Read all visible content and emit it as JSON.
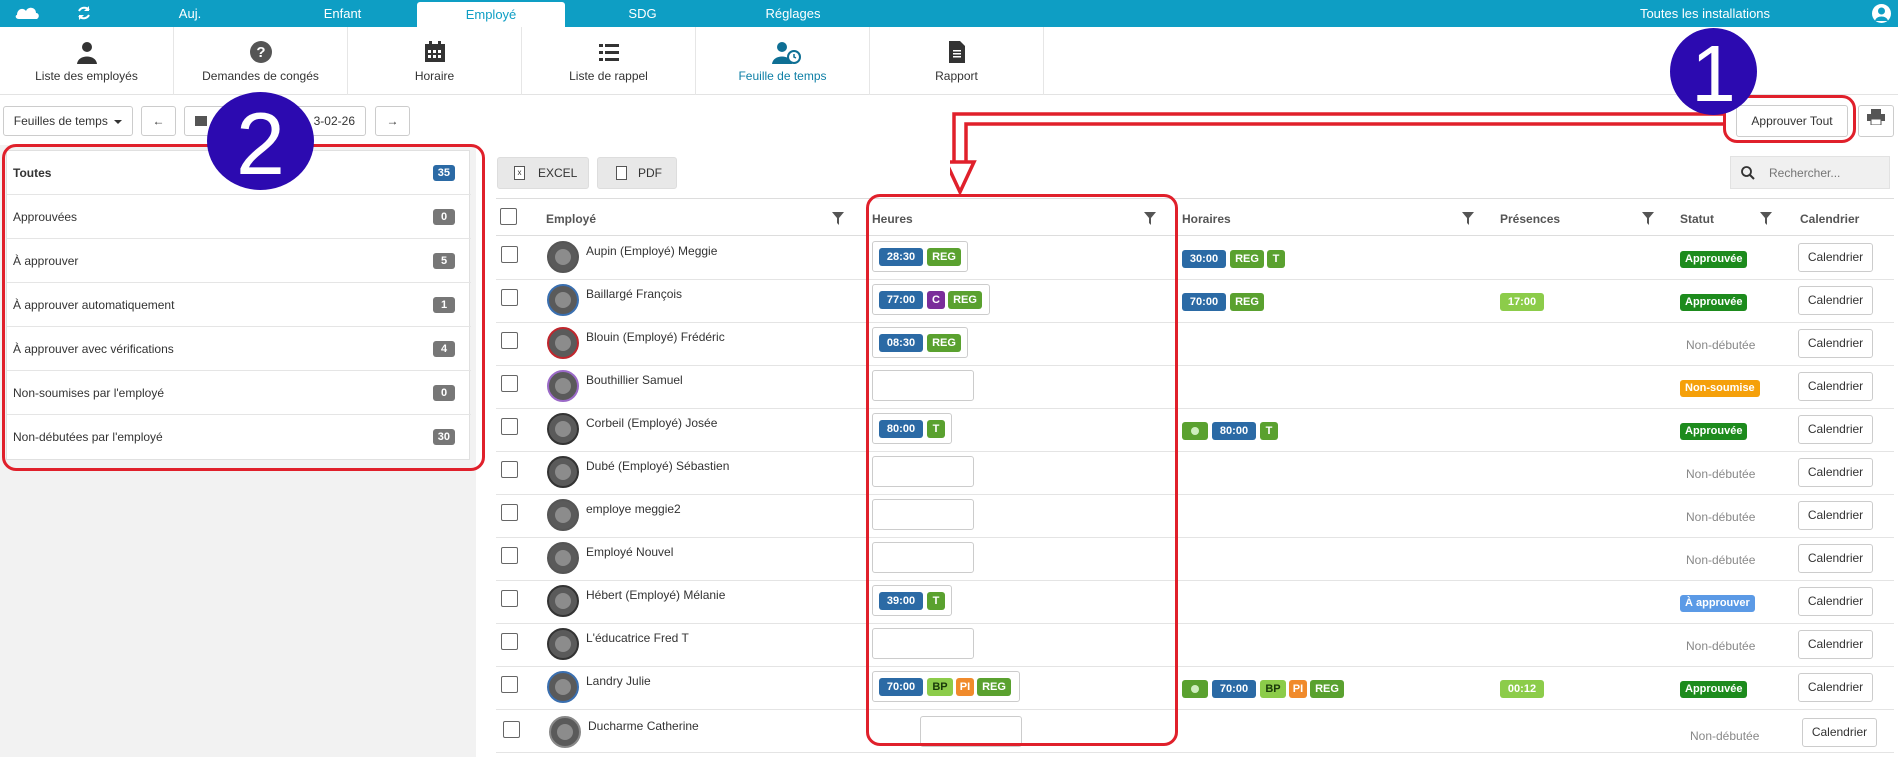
{
  "topnav": {
    "tabs": [
      "Auj.",
      "Enfant",
      "Employé",
      "SDG",
      "Réglages"
    ],
    "active_tab": "Employé",
    "installations": "Toutes les installations"
  },
  "subnav": {
    "items": [
      "Liste des employés",
      "Demandes de congés",
      "Horaire",
      "Liste de rappel",
      "Feuille de temps",
      "Rapport"
    ],
    "active": "Feuille de temps"
  },
  "toolbar": {
    "view_select": "Feuilles de temps",
    "date": "3-02-26",
    "approve_all": "Approuver Tout",
    "excel": "EXCEL",
    "pdf": "PDF",
    "search_placeholder": "Rechercher..."
  },
  "filters": [
    {
      "label": "Toutes",
      "count": "35"
    },
    {
      "label": "Approuvées",
      "count": "0"
    },
    {
      "label": "À approuver",
      "count": "5"
    },
    {
      "label": "À approuver automatiquement",
      "count": "1"
    },
    {
      "label": "À approuver avec vérifications",
      "count": "4"
    },
    {
      "label": "Non-soumises par l'employé",
      "count": "0"
    },
    {
      "label": "Non-débutées par l'employé",
      "count": "30"
    }
  ],
  "columns": [
    "Employé",
    "Heures",
    "Horaires",
    "Présences",
    "Statut",
    "Calendrier"
  ],
  "calendar_label": "Calendrier",
  "rows": [
    {
      "name": "Aupin (Employé) Meggie",
      "hours": "28:30",
      "hours_tags": [
        "REG"
      ],
      "sched": "30:00",
      "sched_tags": [
        "REG",
        "T"
      ],
      "pres": "",
      "status": "Approuvée"
    },
    {
      "name": "Baillargé François",
      "hours": "77:00",
      "hours_tags": [
        "C",
        "REG"
      ],
      "sched": "70:00",
      "sched_tags": [
        "REG"
      ],
      "pres": "17:00",
      "status": "Approuvée"
    },
    {
      "name": "Blouin (Employé) Frédéric",
      "hours": "08:30",
      "hours_tags": [
        "REG"
      ],
      "sched": "",
      "sched_tags": [],
      "pres": "",
      "status": "Non-débutée"
    },
    {
      "name": "Bouthillier Samuel",
      "hours": "",
      "hours_tags": [],
      "sched": "",
      "sched_tags": [],
      "pres": "",
      "status": "Non-soumise"
    },
    {
      "name": "Corbeil (Employé) Josée",
      "hours": "80:00",
      "hours_tags": [
        "T"
      ],
      "sched": "80:00",
      "sched_tags": [
        "T"
      ],
      "pres": "",
      "status": "Approuvée"
    },
    {
      "name": "Dubé (Employé) Sébastien",
      "hours": "",
      "hours_tags": [],
      "sched": "",
      "sched_tags": [],
      "pres": "",
      "status": "Non-débutée"
    },
    {
      "name": "employe meggie2",
      "hours": "",
      "hours_tags": [],
      "sched": "",
      "sched_tags": [],
      "pres": "",
      "status": "Non-débutée"
    },
    {
      "name": "Employé Nouvel",
      "hours": "",
      "hours_tags": [],
      "sched": "",
      "sched_tags": [],
      "pres": "",
      "status": "Non-débutée"
    },
    {
      "name": "Hébert (Employé) Mélanie",
      "hours": "39:00",
      "hours_tags": [
        "T"
      ],
      "sched": "",
      "sched_tags": [],
      "pres": "",
      "status": "À approuver"
    },
    {
      "name": "L'éducatrice Fred T",
      "hours": "",
      "hours_tags": [],
      "sched": "",
      "sched_tags": [],
      "pres": "",
      "status": "Non-débutée"
    },
    {
      "name": "Landry Julie",
      "hours": "70:00",
      "hours_tags": [
        "BP",
        "PI",
        "REG"
      ],
      "sched": "70:00",
      "sched_tags": [
        "BP",
        "PI",
        "REG"
      ],
      "pres": "00:12",
      "status": "Approuvée"
    },
    {
      "name": "Ducharme Catherine",
      "hours": "",
      "hours_tags": [],
      "sched": "",
      "sched_tags": [],
      "pres": "",
      "status": "Non-débutée"
    }
  ],
  "annotations": [
    "1",
    "2"
  ]
}
